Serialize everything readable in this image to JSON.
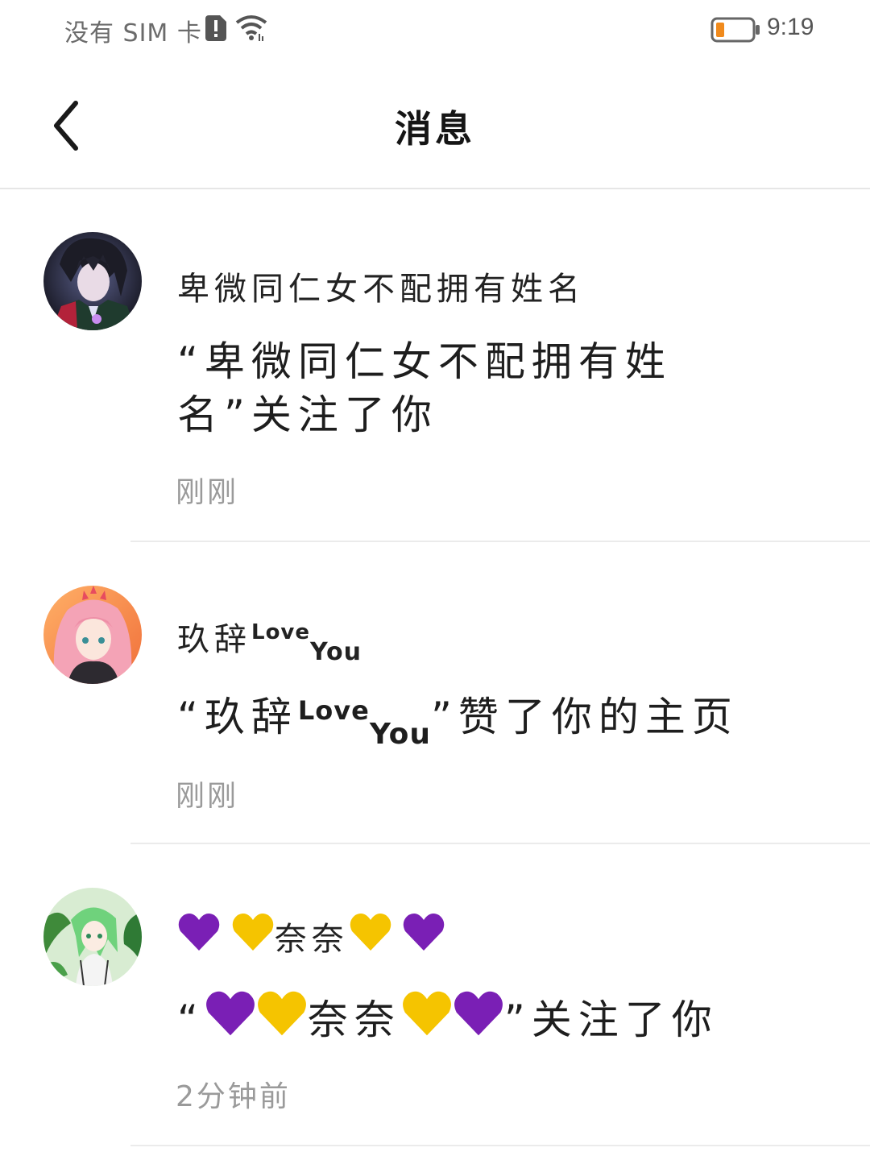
{
  "status_bar": {
    "carrier": "没有 SIM 卡",
    "time": "9:19",
    "battery_color": "#f08a1c"
  },
  "header": {
    "title": "消息",
    "back_icon": "chevron-left-icon"
  },
  "messages": [
    {
      "sender": "卑微同仁女不配拥有姓名",
      "action": "“卑微同仁女不配拥有姓名”关注了你",
      "time": "刚刚"
    },
    {
      "sender_main": "玖辞",
      "sender_love": "Love",
      "sender_you": "You",
      "action_open": "“玖辞",
      "action_love": "Love",
      "action_you": "You",
      "action_close": "”赞了你的主页",
      "time": "刚刚"
    },
    {
      "sender_name": "奈奈",
      "action_open": "“",
      "action_name": "奈奈",
      "action_close": "”关注了你",
      "time": "2分钟前",
      "heart_colors": {
        "purple": "#7a1fb5",
        "yellow": "#f5c400"
      }
    }
  ]
}
